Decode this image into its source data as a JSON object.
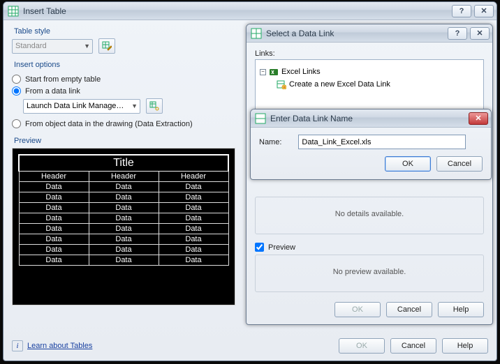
{
  "main": {
    "title": "Insert Table",
    "table_style": {
      "label": "Table style",
      "value": "Standard"
    },
    "insert_options": {
      "label": "Insert options",
      "opt_empty": "Start from empty table",
      "opt_link": "From a data link",
      "link_select": "Launch Data Link Manage…",
      "opt_extraction": "From object data in the drawing (Data Extraction)"
    },
    "preview": {
      "label": "Preview",
      "title_cell": "Title",
      "header": "Header",
      "data": "Data"
    },
    "learn_link": "Learn about Tables",
    "buttons": {
      "ok": "OK",
      "cancel": "Cancel",
      "help": "Help"
    }
  },
  "mid": {
    "title": "Select a Data Link",
    "links_label": "Links:",
    "tree_root": "Excel Links",
    "tree_item": "Create a new Excel Data Link",
    "no_details": "No details available.",
    "preview_label": "Preview",
    "no_preview": "No preview available.",
    "buttons": {
      "ok": "OK",
      "cancel": "Cancel",
      "help": "Help"
    }
  },
  "top": {
    "title": "Enter Data Link Name",
    "name_label": "Name:",
    "name_value": "Data_Link_Excel.xls",
    "buttons": {
      "ok": "OK",
      "cancel": "Cancel"
    }
  }
}
